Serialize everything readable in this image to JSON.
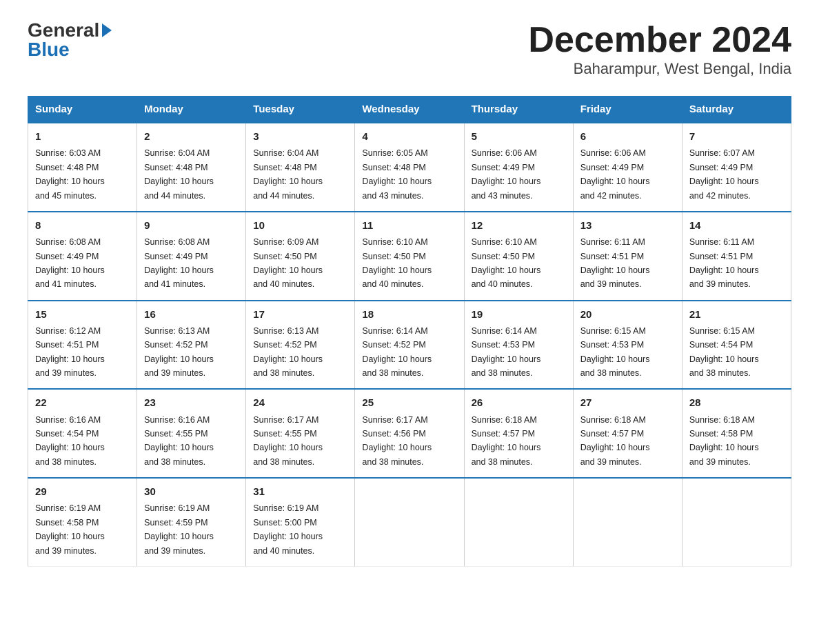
{
  "logo": {
    "general": "General",
    "blue": "Blue"
  },
  "title": "December 2024",
  "location": "Baharampur, West Bengal, India",
  "headers": [
    "Sunday",
    "Monday",
    "Tuesday",
    "Wednesday",
    "Thursday",
    "Friday",
    "Saturday"
  ],
  "weeks": [
    [
      {
        "day": "1",
        "info": "Sunrise: 6:03 AM\nSunset: 4:48 PM\nDaylight: 10 hours\nand 45 minutes."
      },
      {
        "day": "2",
        "info": "Sunrise: 6:04 AM\nSunset: 4:48 PM\nDaylight: 10 hours\nand 44 minutes."
      },
      {
        "day": "3",
        "info": "Sunrise: 6:04 AM\nSunset: 4:48 PM\nDaylight: 10 hours\nand 44 minutes."
      },
      {
        "day": "4",
        "info": "Sunrise: 6:05 AM\nSunset: 4:48 PM\nDaylight: 10 hours\nand 43 minutes."
      },
      {
        "day": "5",
        "info": "Sunrise: 6:06 AM\nSunset: 4:49 PM\nDaylight: 10 hours\nand 43 minutes."
      },
      {
        "day": "6",
        "info": "Sunrise: 6:06 AM\nSunset: 4:49 PM\nDaylight: 10 hours\nand 42 minutes."
      },
      {
        "day": "7",
        "info": "Sunrise: 6:07 AM\nSunset: 4:49 PM\nDaylight: 10 hours\nand 42 minutes."
      }
    ],
    [
      {
        "day": "8",
        "info": "Sunrise: 6:08 AM\nSunset: 4:49 PM\nDaylight: 10 hours\nand 41 minutes."
      },
      {
        "day": "9",
        "info": "Sunrise: 6:08 AM\nSunset: 4:49 PM\nDaylight: 10 hours\nand 41 minutes."
      },
      {
        "day": "10",
        "info": "Sunrise: 6:09 AM\nSunset: 4:50 PM\nDaylight: 10 hours\nand 40 minutes."
      },
      {
        "day": "11",
        "info": "Sunrise: 6:10 AM\nSunset: 4:50 PM\nDaylight: 10 hours\nand 40 minutes."
      },
      {
        "day": "12",
        "info": "Sunrise: 6:10 AM\nSunset: 4:50 PM\nDaylight: 10 hours\nand 40 minutes."
      },
      {
        "day": "13",
        "info": "Sunrise: 6:11 AM\nSunset: 4:51 PM\nDaylight: 10 hours\nand 39 minutes."
      },
      {
        "day": "14",
        "info": "Sunrise: 6:11 AM\nSunset: 4:51 PM\nDaylight: 10 hours\nand 39 minutes."
      }
    ],
    [
      {
        "day": "15",
        "info": "Sunrise: 6:12 AM\nSunset: 4:51 PM\nDaylight: 10 hours\nand 39 minutes."
      },
      {
        "day": "16",
        "info": "Sunrise: 6:13 AM\nSunset: 4:52 PM\nDaylight: 10 hours\nand 39 minutes."
      },
      {
        "day": "17",
        "info": "Sunrise: 6:13 AM\nSunset: 4:52 PM\nDaylight: 10 hours\nand 38 minutes."
      },
      {
        "day": "18",
        "info": "Sunrise: 6:14 AM\nSunset: 4:52 PM\nDaylight: 10 hours\nand 38 minutes."
      },
      {
        "day": "19",
        "info": "Sunrise: 6:14 AM\nSunset: 4:53 PM\nDaylight: 10 hours\nand 38 minutes."
      },
      {
        "day": "20",
        "info": "Sunrise: 6:15 AM\nSunset: 4:53 PM\nDaylight: 10 hours\nand 38 minutes."
      },
      {
        "day": "21",
        "info": "Sunrise: 6:15 AM\nSunset: 4:54 PM\nDaylight: 10 hours\nand 38 minutes."
      }
    ],
    [
      {
        "day": "22",
        "info": "Sunrise: 6:16 AM\nSunset: 4:54 PM\nDaylight: 10 hours\nand 38 minutes."
      },
      {
        "day": "23",
        "info": "Sunrise: 6:16 AM\nSunset: 4:55 PM\nDaylight: 10 hours\nand 38 minutes."
      },
      {
        "day": "24",
        "info": "Sunrise: 6:17 AM\nSunset: 4:55 PM\nDaylight: 10 hours\nand 38 minutes."
      },
      {
        "day": "25",
        "info": "Sunrise: 6:17 AM\nSunset: 4:56 PM\nDaylight: 10 hours\nand 38 minutes."
      },
      {
        "day": "26",
        "info": "Sunrise: 6:18 AM\nSunset: 4:57 PM\nDaylight: 10 hours\nand 38 minutes."
      },
      {
        "day": "27",
        "info": "Sunrise: 6:18 AM\nSunset: 4:57 PM\nDaylight: 10 hours\nand 39 minutes."
      },
      {
        "day": "28",
        "info": "Sunrise: 6:18 AM\nSunset: 4:58 PM\nDaylight: 10 hours\nand 39 minutes."
      }
    ],
    [
      {
        "day": "29",
        "info": "Sunrise: 6:19 AM\nSunset: 4:58 PM\nDaylight: 10 hours\nand 39 minutes."
      },
      {
        "day": "30",
        "info": "Sunrise: 6:19 AM\nSunset: 4:59 PM\nDaylight: 10 hours\nand 39 minutes."
      },
      {
        "day": "31",
        "info": "Sunrise: 6:19 AM\nSunset: 5:00 PM\nDaylight: 10 hours\nand 40 minutes."
      },
      {
        "day": "",
        "info": ""
      },
      {
        "day": "",
        "info": ""
      },
      {
        "day": "",
        "info": ""
      },
      {
        "day": "",
        "info": ""
      }
    ]
  ]
}
